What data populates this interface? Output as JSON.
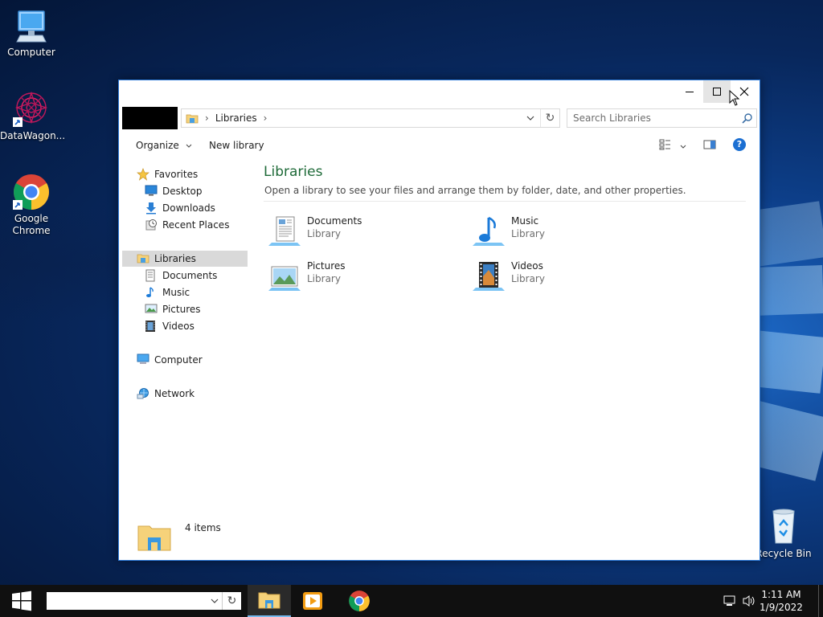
{
  "desktop": {
    "icons": [
      {
        "label": "Computer"
      },
      {
        "label": "DataWagon..."
      },
      {
        "label": "Google Chrome"
      },
      {
        "label": "Recycle Bin"
      }
    ]
  },
  "window": {
    "address": {
      "crumb": "Libraries",
      "separator": "›"
    },
    "search_placeholder": "Search Libraries",
    "commands": {
      "organize": "Organize",
      "new_library": "New library"
    },
    "help_glyph": "?",
    "sidebar": {
      "favorites": {
        "label": "Favorites",
        "items": [
          "Desktop",
          "Downloads",
          "Recent Places"
        ]
      },
      "libraries": {
        "label": "Libraries",
        "items": [
          "Documents",
          "Music",
          "Pictures",
          "Videos"
        ]
      },
      "computer": "Computer",
      "network": "Network"
    },
    "content": {
      "title": "Libraries",
      "description": "Open a library to see your files and arrange them by folder, date, and other properties.",
      "tiles": [
        {
          "name": "Documents",
          "type": "Library",
          "icon": "documents-library-icon"
        },
        {
          "name": "Music",
          "type": "Library",
          "icon": "music-library-icon"
        },
        {
          "name": "Pictures",
          "type": "Library",
          "icon": "pictures-library-icon"
        },
        {
          "name": "Videos",
          "type": "Library",
          "icon": "videos-library-icon"
        }
      ]
    },
    "status": {
      "count": "4 items"
    }
  },
  "taskbar": {
    "clock": {
      "time": "1:11 AM",
      "date": "1/9/2022"
    }
  },
  "colors": {
    "accent": "#2b79d8",
    "library_title": "#1e6a38",
    "selection": "#d9d9d9",
    "help": "#1b6fd2"
  }
}
